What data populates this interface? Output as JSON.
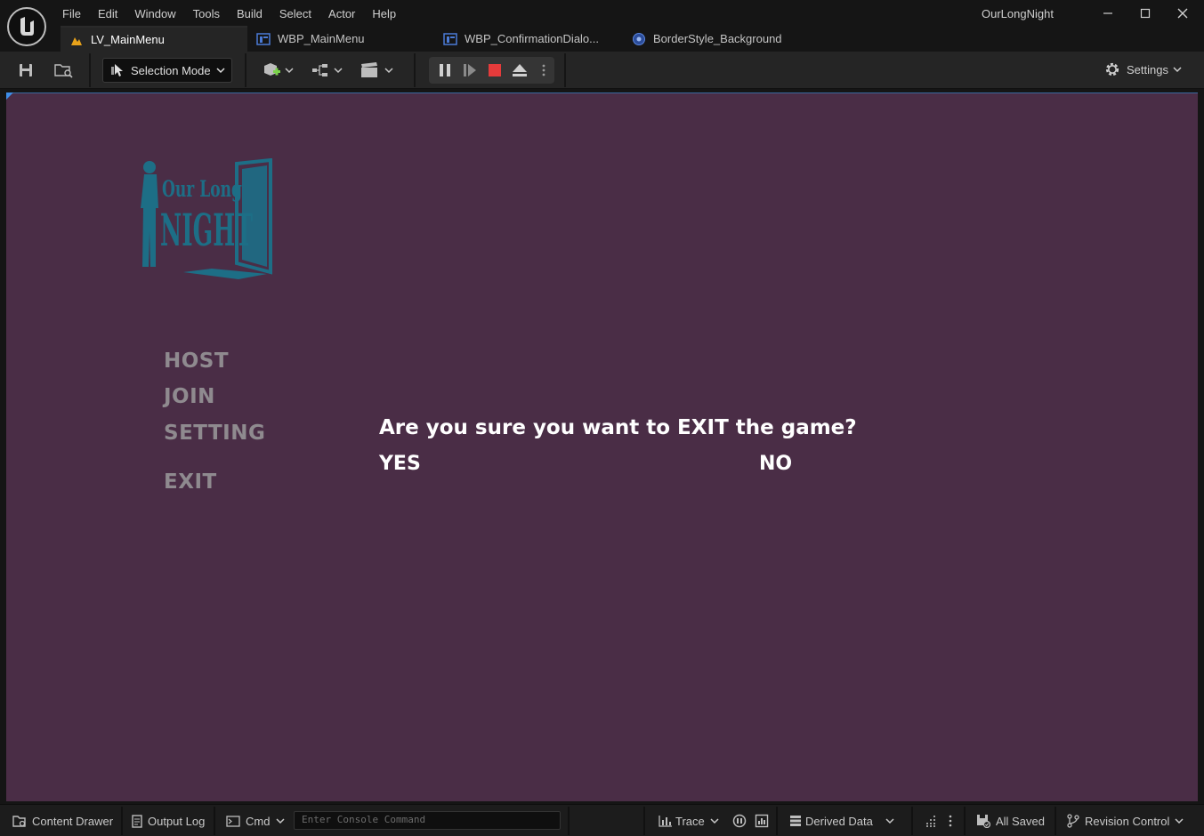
{
  "titlebar": {
    "menus": [
      "File",
      "Edit",
      "Window",
      "Tools",
      "Build",
      "Select",
      "Actor",
      "Help"
    ],
    "project_name": "OurLongNight"
  },
  "tabs": [
    {
      "label": "LV_MainMenu",
      "icon": "level-icon",
      "active": true
    },
    {
      "label": "WBP_MainMenu",
      "icon": "widget-blueprint-icon",
      "active": false
    },
    {
      "label": "WBP_ConfirmationDialo...",
      "icon": "widget-blueprint-icon",
      "active": false
    },
    {
      "label": "BorderStyle_Background",
      "icon": "style-asset-icon",
      "active": false
    }
  ],
  "toolbar": {
    "selection_mode": "Selection Mode",
    "settings": "Settings"
  },
  "game": {
    "logo_line1": "Our Long",
    "logo_line2": "NIGHT",
    "menu": {
      "host": "HOST",
      "join": "JOIN",
      "setting": "SETTING",
      "exit": "EXIT"
    },
    "dialog": {
      "question": "Are you sure you want to EXIT the game?",
      "yes": "YES",
      "no": "NO"
    }
  },
  "statusbar": {
    "content_drawer": "Content Drawer",
    "output_log": "Output Log",
    "cmd": "Cmd",
    "console_placeholder": "Enter Console Command",
    "trace": "Trace",
    "derived_data": "Derived Data",
    "all_saved": "All Saved",
    "revision_control": "Revision Control"
  },
  "colors": {
    "viewport_bg": "#4a2d46",
    "logo_teal": "#1d6e86",
    "menu_option": "#8f8a8f",
    "stop_red": "#e53b3b",
    "add_green": "#7bd44a",
    "level_orange": "#e8a21a",
    "widget_blue": "#4b7bd6"
  }
}
